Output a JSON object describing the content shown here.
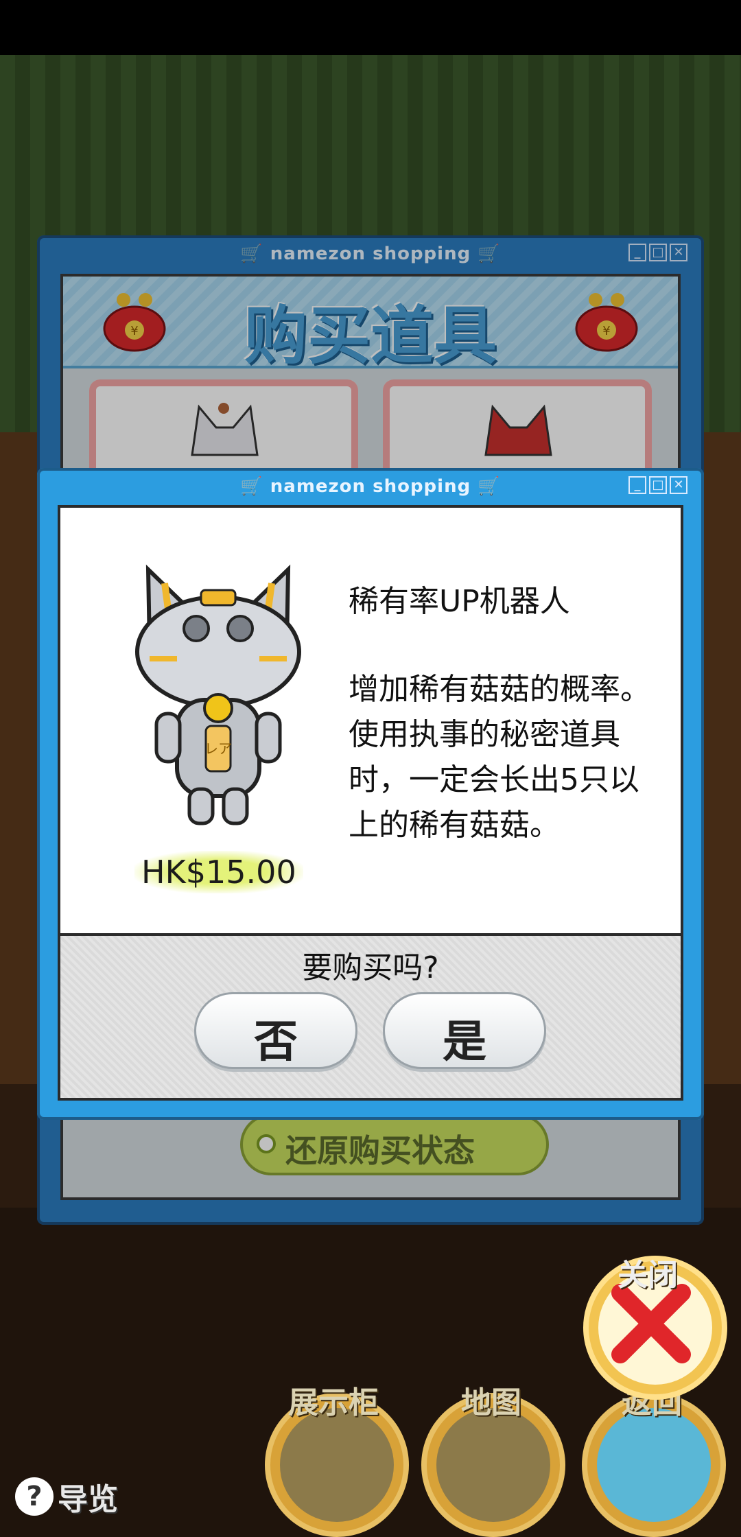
{
  "back_window": {
    "title": "namezon shopping",
    "banner_title": "购买道具",
    "restore_button": "还原购买状态"
  },
  "dialog": {
    "title": "namezon shopping",
    "item_name": "稀有率UP机器人",
    "item_description": "增加稀有菇菇的概率。使用执事的秘密道具时，一定会长出5只以上的稀有菇菇。",
    "item_badge": "レア",
    "price": "HK$15.00",
    "question": "要购买吗?",
    "no_button": "否",
    "yes_button": "是"
  },
  "hud": {
    "close_label": "关闭",
    "showcase_label": "展示柜",
    "map_label": "地图",
    "back_label": "返回",
    "guide_label": "导览"
  },
  "window_controls": [
    "_",
    "□",
    "✕"
  ],
  "colors": {
    "window_blue": "#2c9de0",
    "banner_text": "#4a9fd6",
    "price_highlight": "#e4f27a",
    "close_x": "#e0262a"
  }
}
